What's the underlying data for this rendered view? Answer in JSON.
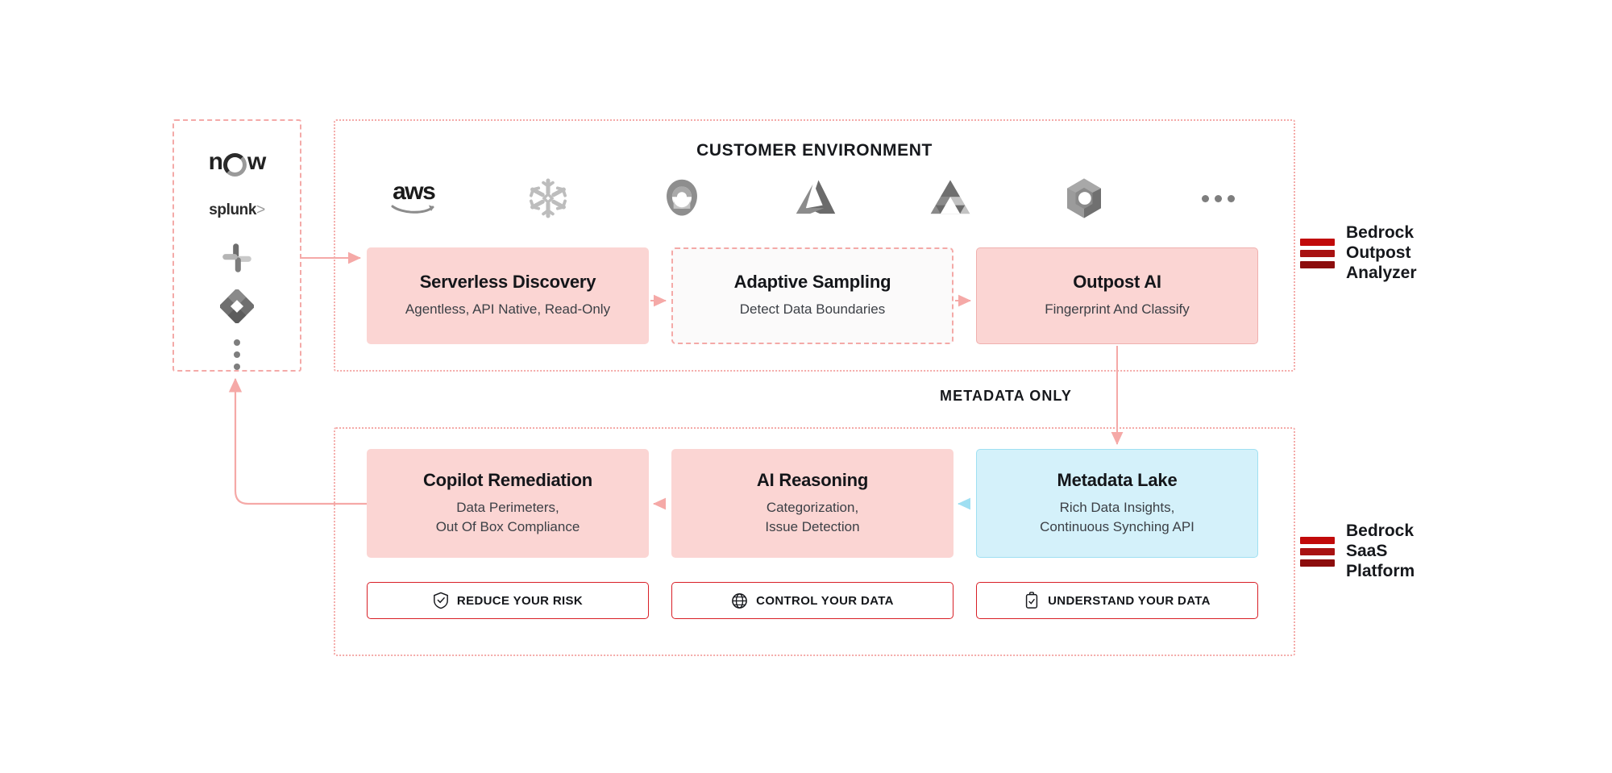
{
  "diagram": {
    "customer_environment_title": "CUSTOMER ENVIRONMENT",
    "metadata_label": "METADATA ONLY"
  },
  "colors": {
    "pink_fill": "#fbd5d3",
    "pink_border": "#f4a9a7",
    "blue_fill": "#d4f1fa",
    "blue_border": "#9fe0f2",
    "legend_red": "#c10a0a",
    "button_border": "#d81f26",
    "text_dark": "#14161a"
  },
  "integrations": {
    "items": [
      {
        "name": "servicenow",
        "label": "now"
      },
      {
        "name": "splunk",
        "label": "splunk"
      },
      {
        "name": "slack",
        "label": "Slack"
      },
      {
        "name": "jira",
        "label": "Jira"
      },
      {
        "name": "more",
        "label": "..."
      }
    ]
  },
  "cloud_logos": {
    "items": [
      {
        "name": "aws",
        "label": "aws"
      },
      {
        "name": "snowflake",
        "label": "Snowflake"
      },
      {
        "name": "google-cloud",
        "label": "Google Cloud"
      },
      {
        "name": "azure",
        "label": "Azure"
      },
      {
        "name": "google-drive",
        "label": "Google Drive"
      },
      {
        "name": "microsoft-365",
        "label": "Microsoft 365"
      },
      {
        "name": "more",
        "label": "..."
      }
    ]
  },
  "flow": {
    "customer_row": [
      {
        "title": "Serverless Discovery",
        "subtitle": "Agentless, API Native, Read-Only",
        "style": "pink"
      },
      {
        "title": "Adaptive Sampling",
        "subtitle": "Detect Data Boundaries",
        "style": "dashed"
      },
      {
        "title": "Outpost AI",
        "subtitle": "Fingerprint And Classify",
        "style": "pink-solid"
      }
    ],
    "saas_row": [
      {
        "title": "Copilot Remediation",
        "subtitle_line1": "Data Perimeters,",
        "subtitle_line2": "Out Of Box Compliance",
        "style": "pink"
      },
      {
        "title": "AI Reasoning",
        "subtitle_line1": "Categorization,",
        "subtitle_line2": "Issue Detection",
        "style": "pink"
      },
      {
        "title": "Metadata Lake",
        "subtitle_line1": "Rich Data Insights,",
        "subtitle_line2": "Continuous Synching API",
        "style": "blue"
      }
    ]
  },
  "buttons": [
    {
      "label": "REDUCE YOUR RISK",
      "icon": "shield-check-icon"
    },
    {
      "label": "CONTROL YOUR DATA",
      "icon": "globe-icon"
    },
    {
      "label": "UNDERSTAND YOUR DATA",
      "icon": "clipboard-check-icon"
    }
  ],
  "legends": [
    {
      "title": "Bedrock\nOutpost\nAnalyzer"
    },
    {
      "title": "Bedrock\nSaaS\nPlatform"
    }
  ]
}
